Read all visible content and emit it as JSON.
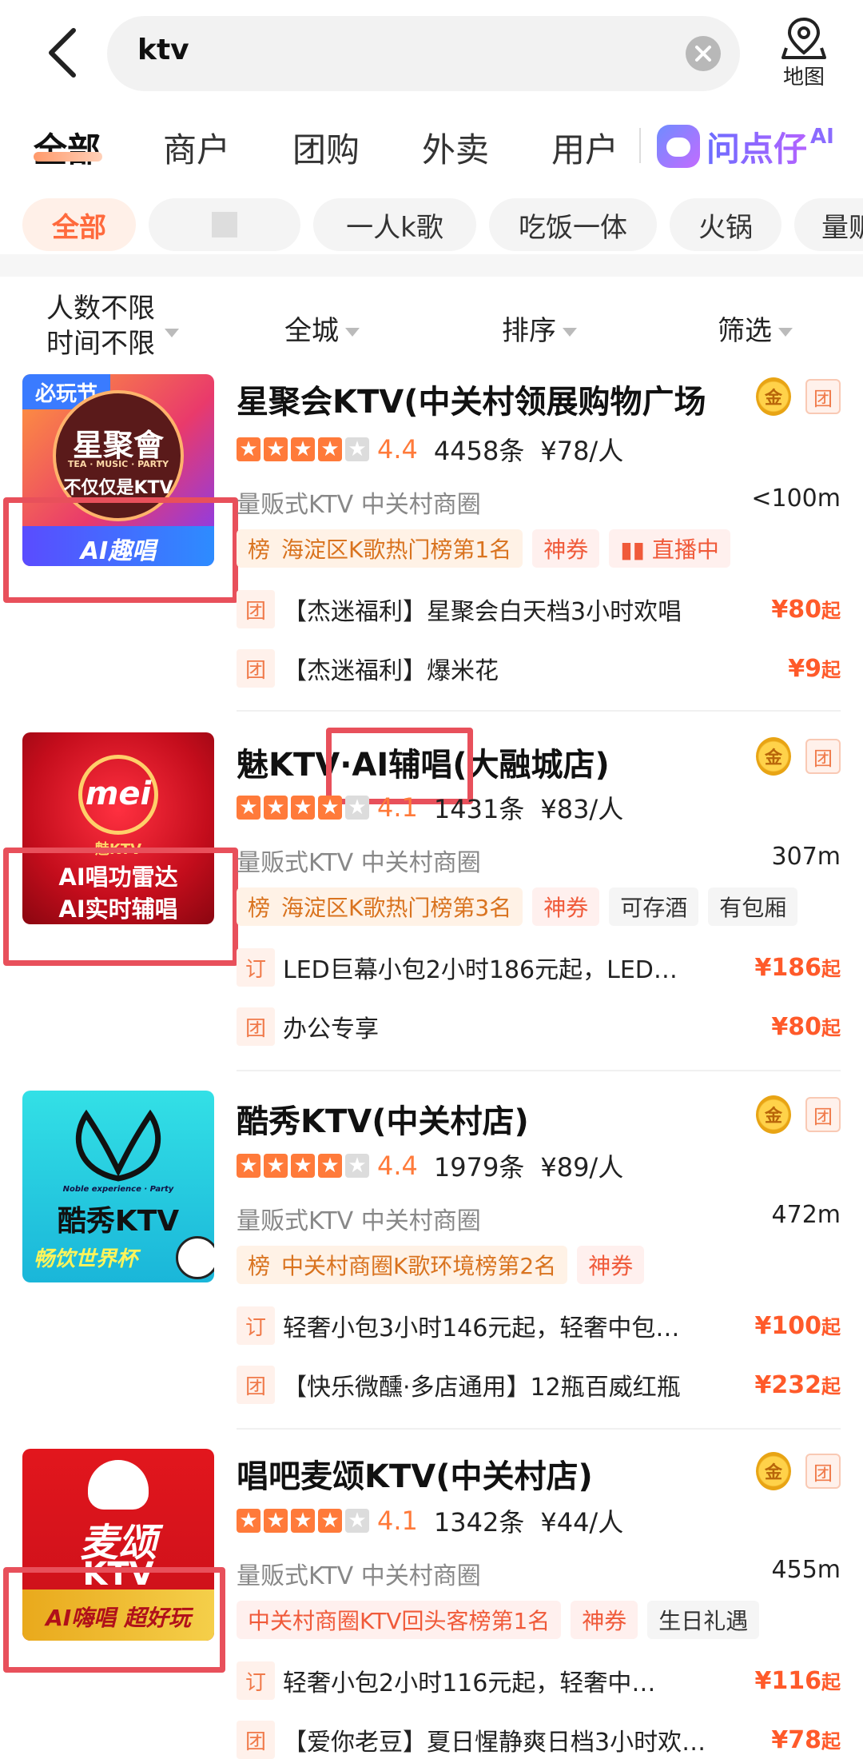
{
  "header": {
    "query": "ktv",
    "map_label": "地图"
  },
  "tabs": [
    {
      "label": "全部"
    },
    {
      "label": "商户"
    },
    {
      "label": "团购"
    },
    {
      "label": "外卖"
    },
    {
      "label": "用户"
    }
  ],
  "ai_tab": {
    "label": "问点仔",
    "sup": "AI"
  },
  "chips": [
    {
      "label": "全部"
    },
    {
      "label": ""
    },
    {
      "label": "一人k歌"
    },
    {
      "label": "吃饭一体"
    },
    {
      "label": "火锅"
    },
    {
      "label": "量贩"
    }
  ],
  "filters": {
    "people": "人数不限",
    "time": "时间不限",
    "area": "全城",
    "sort": "排序",
    "filter": "筛选"
  },
  "shops": [
    {
      "name": "星聚会KTV(中关村领展购物广场",
      "score": "4.4",
      "reviews": "4458条",
      "price": "¥78/人",
      "category": "量贩式KTV  中关村商圈",
      "distance": "<100m",
      "medal": "金",
      "group": "团",
      "thumb_top": "必玩节",
      "thumb_brand": "星聚會",
      "thumb_sub": "TEA · MUSIC · PARTY",
      "thumb_slogan": "不仅仅是KTV",
      "thumb_bottom": "AI趣唱",
      "tags": [
        {
          "kind": "rank",
          "badge": "榜",
          "text": "海淀区K歌热门榜第1名"
        },
        {
          "kind": "coupon",
          "text": "神券"
        },
        {
          "kind": "live",
          "text": "▮▮ 直播中"
        }
      ],
      "deals": [
        {
          "badge": "团",
          "text": "【杰迷福利】星聚会白天档3小时欢唱",
          "price": "¥80",
          "suffix": "起"
        },
        {
          "badge": "团",
          "text": "【杰迷福利】爆米花",
          "price": "¥9",
          "suffix": "起"
        }
      ]
    },
    {
      "name": "魅KTV·AI辅唱(大融城店)",
      "score": "4.1",
      "reviews": "1431条",
      "price": "¥83/人",
      "category": "量贩式KTV  中关村商圈",
      "distance": "307m",
      "medal": "金",
      "group": "团",
      "thumb_brand": "mei",
      "thumb_sub": "魅KTV",
      "thumb_line1": "AI唱功雷达",
      "thumb_line2": "AI实时辅唱",
      "tags": [
        {
          "kind": "rank",
          "badge": "榜",
          "text": "海淀区K歌热门榜第3名"
        },
        {
          "kind": "coupon",
          "text": "神券"
        },
        {
          "kind": "plain",
          "text": "可存酒"
        },
        {
          "kind": "plain",
          "text": "有包厢"
        }
      ],
      "deals": [
        {
          "badge": "订",
          "text": "LED巨幕小包2小时186元起，LED…",
          "price": "¥186",
          "suffix": "起"
        },
        {
          "badge": "团",
          "text": "办公专享",
          "price": "¥80",
          "suffix": "起"
        }
      ]
    },
    {
      "name": "酷秀KTV(中关村店)",
      "score": "4.4",
      "reviews": "1979条",
      "price": "¥89/人",
      "category": "量贩式KTV  中关村商圈",
      "distance": "472m",
      "medal": "金",
      "group": "团",
      "thumb_script": "Noble experience · Party",
      "thumb_brand": "酷秀KTV",
      "thumb_bottom": "畅饮世界杯",
      "tags": [
        {
          "kind": "rank",
          "badge": "榜",
          "text": "中关村商圈K歌环境榜第2名"
        },
        {
          "kind": "coupon",
          "text": "神券"
        }
      ],
      "deals": [
        {
          "badge": "订",
          "text": "轻奢小包3小时146元起，轻奢中包…",
          "price": "¥100",
          "suffix": "起"
        },
        {
          "badge": "团",
          "text": "【快乐微醺·多店通用】12瓶百威红瓶",
          "price": "¥232",
          "suffix": "起"
        }
      ]
    },
    {
      "name": "唱吧麦颂KTV(中关村店)",
      "score": "4.1",
      "reviews": "1342条",
      "price": "¥44/人",
      "category": "量贩式KTV  中关村商圈",
      "distance": "455m",
      "medal": "金",
      "group": "团",
      "thumb_brand": "麦颂",
      "thumb_sub": "KTV",
      "thumb_bottom": "AI嗨唱 超好玩",
      "tags": [
        {
          "kind": "coupon2",
          "text": "中关村商圈KTV回头客榜第1名"
        },
        {
          "kind": "coupon",
          "text": "神券"
        },
        {
          "kind": "plain",
          "text": "生日礼遇"
        }
      ],
      "deals": [
        {
          "badge": "订",
          "text": "轻奢小包2小时116元起，轻奢中…",
          "price": "¥116",
          "suffix": "起"
        },
        {
          "badge": "团",
          "text": "【爱你老豆】夏日惺静爽日档3小时欢…",
          "price": "¥78",
          "suffix": "起"
        }
      ]
    }
  ]
}
